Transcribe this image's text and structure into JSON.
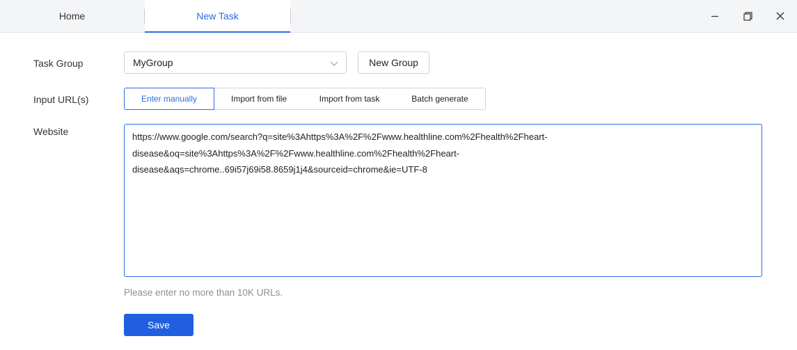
{
  "tabs": {
    "home": "Home",
    "new_task": "New Task"
  },
  "window_controls": {
    "minimize": "minimize-icon",
    "restore": "restore-icon",
    "close": "close-icon"
  },
  "form": {
    "task_group_label": "Task Group",
    "task_group_value": "MyGroup",
    "new_group_label": "New Group",
    "input_urls_label": "Input URL(s)",
    "input_modes": [
      "Enter manually",
      "Import from file",
      "Import from task",
      "Batch generate"
    ],
    "selected_mode": "Enter manually",
    "website_label": "Website",
    "website_lines": [
      "https://www.google.com/search?q=site%3Ahttps%3A%2F%2Fwww.healthline.com%2Fhealth%2Fheart-",
      "disease&oq=site%3Ahttps%3A%2F%2Fwww.healthline.com%2Fhealth%2Fheart-",
      "disease&aqs=chrome..69i57j69i58.8659j1j4&sourceid=chrome&ie=UTF-8"
    ],
    "hint": "Please enter no more than 10K URLs.",
    "save_label": "Save"
  },
  "colors": {
    "accent": "#2a6be0",
    "primary_button": "#1f5fe0",
    "titlebar_bg": "#f4f5f7",
    "hint_text": "#8a8f96"
  }
}
